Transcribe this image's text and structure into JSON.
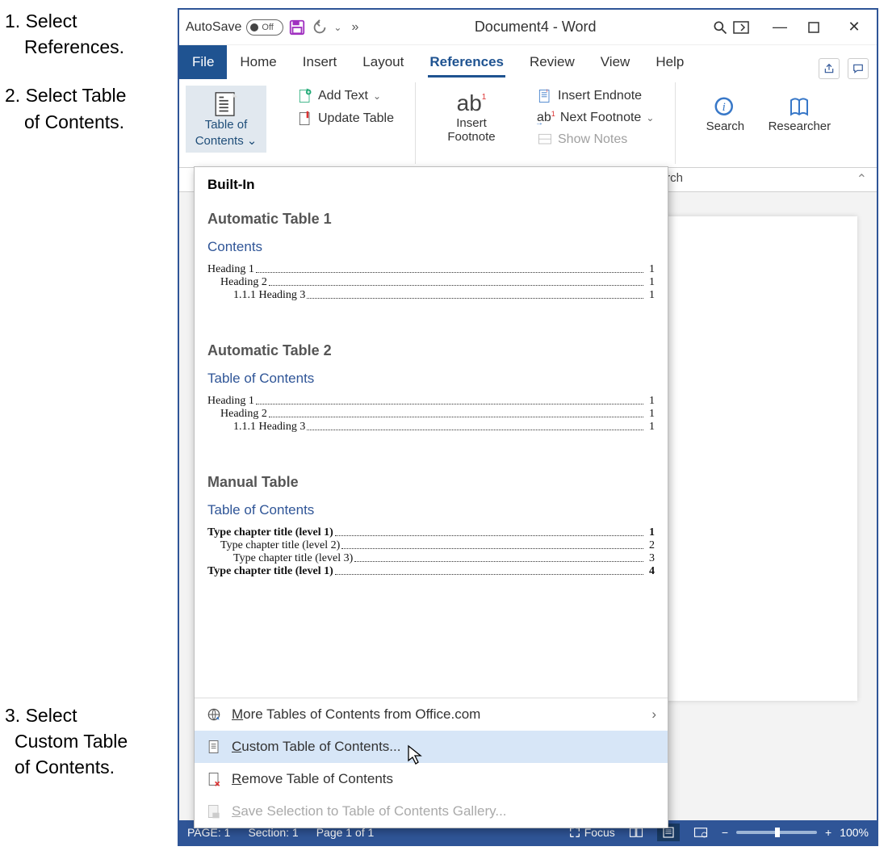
{
  "instructions": {
    "step1a": "1. Select",
    "step1b": "References.",
    "step2a": "2. Select Table",
    "step2b": "of Contents.",
    "step3a": "3. Select",
    "step3b": "Custom Table",
    "step3c": "of Contents."
  },
  "titlebar": {
    "autosave": "AutoSave",
    "autosave_state": "Off",
    "doc_title": "Document4 - Word"
  },
  "tabs": {
    "file": "File",
    "home": "Home",
    "insert": "Insert",
    "layout": "Layout",
    "references": "References",
    "review": "Review",
    "view": "View",
    "help": "Help"
  },
  "ribbon": {
    "toc1": "Table of",
    "toc2": "Contents",
    "add_text": "Add Text",
    "update_table": "Update Table",
    "insert_footnote1": "Insert",
    "insert_footnote2": "Footnote",
    "insert_endnote": "Insert Endnote",
    "next_footnote": "Next Footnote",
    "show_notes": "Show Notes",
    "search": "Search",
    "researcher": "Researcher",
    "group_research": "esearch"
  },
  "dropdown": {
    "header": "Built-In",
    "auto1": {
      "title": "Automatic Table 1",
      "contents": "Contents",
      "h1": "Heading 1",
      "p1": "1",
      "h2": "Heading 2",
      "p2": "1",
      "h3": "1.1.1   Heading 3",
      "p3": "1"
    },
    "auto2": {
      "title": "Automatic Table 2",
      "contents": "Table of Contents",
      "h1": "Heading 1",
      "p1": "1",
      "h2": "Heading 2",
      "p2": "1",
      "h3": "1.1.1   Heading 3",
      "p3": "1"
    },
    "manual": {
      "title": "Manual Table",
      "contents": "Table of Contents",
      "r1": "Type chapter title (level 1)",
      "p1": "1",
      "r2": "Type chapter title (level 2)",
      "p2": "2",
      "r3": "Type chapter title (level 3)",
      "p3": "3",
      "r4": "Type chapter title (level 1)",
      "p4": "4"
    },
    "more": "More Tables of Contents from Office.com",
    "custom": "Custom Table of Contents...",
    "remove": "Remove Table of Contents",
    "save": "Save Selection to Table of Contents Gallery..."
  },
  "status": {
    "page": "PAGE: 1",
    "section": "Section: 1",
    "pageof": "Page 1 of 1",
    "focus": "Focus",
    "zoom": "100%"
  }
}
